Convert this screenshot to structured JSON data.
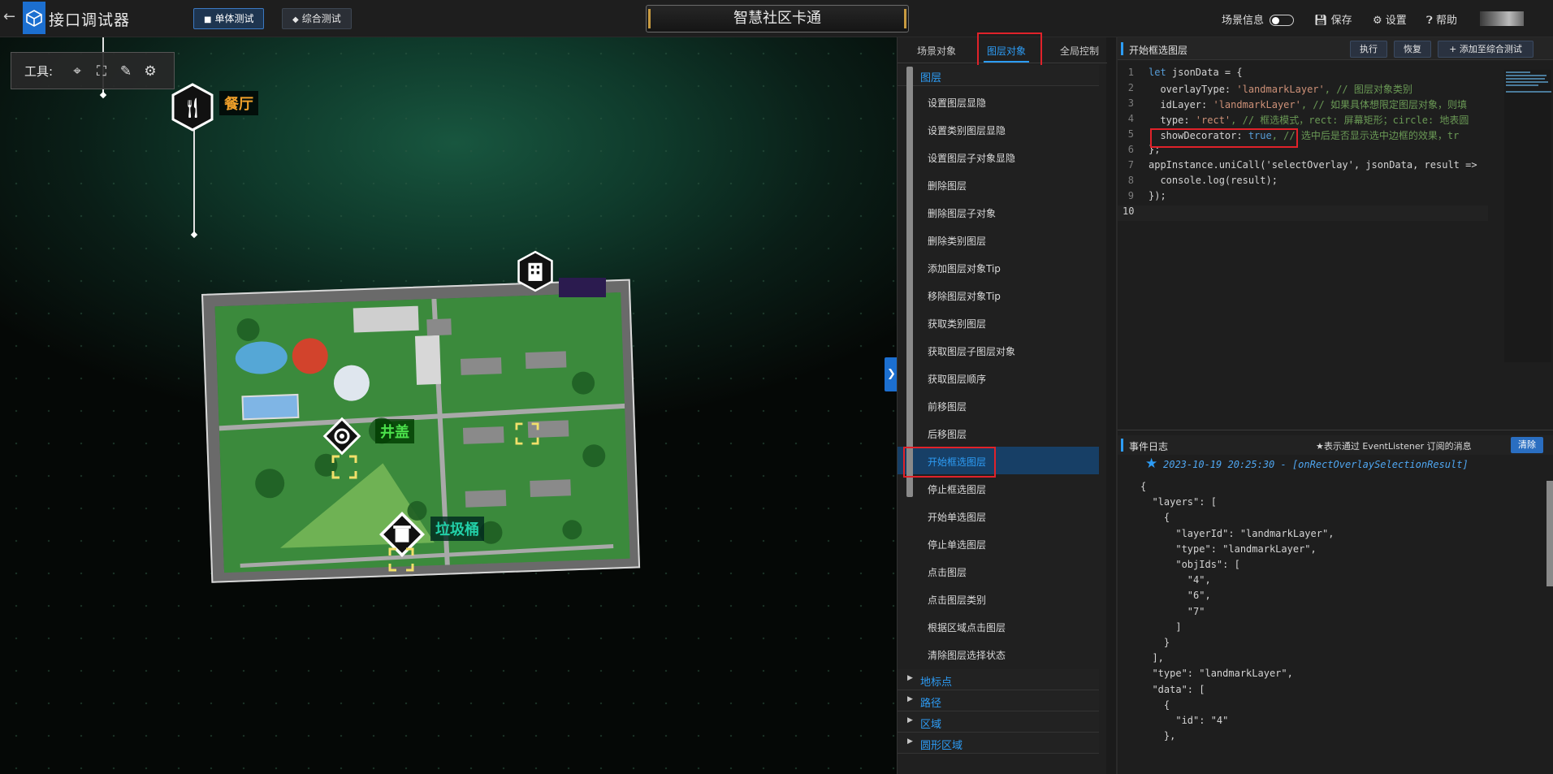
{
  "app": {
    "title": "接口调试器"
  },
  "header": {
    "tabs": [
      {
        "label": "单体测试"
      },
      {
        "label": "综合测试"
      }
    ],
    "scene_title": "智慧社区卡通",
    "scene_info_label": "场景信息",
    "save_label": "保存",
    "settings_label": "设置",
    "help_label": "帮助"
  },
  "toolbar": {
    "label": "工具:"
  },
  "pois": [
    {
      "label": "餐厅",
      "color": "#f0a02a"
    },
    {
      "label": "井盖",
      "color": "#4be04b"
    },
    {
      "label": "垃圾桶",
      "color": "#22d0a8"
    }
  ],
  "middle": {
    "tabs": [
      {
        "label": "场景对象"
      },
      {
        "label": "图层对象"
      },
      {
        "label": "全局控制"
      }
    ],
    "group_open": "图层",
    "items": [
      "设置图层显隐",
      "设置类别图层显隐",
      "设置图层子对象显隐",
      "删除图层",
      "删除图层子对象",
      "删除类别图层",
      "添加图层对象Tip",
      "移除图层对象Tip",
      "获取类别图层",
      "获取图层子图层对象",
      "获取图层顺序",
      "前移图层",
      "后移图层",
      "开始框选图层",
      "停止框选图层",
      "开始单选图层",
      "停止单选图层",
      "点击图层",
      "点击图层类别",
      "根据区域点击图层",
      "清除图层选择状态"
    ],
    "groups_collapsed": [
      "地标点",
      "路径",
      "区域",
      "圆形区域"
    ]
  },
  "editor": {
    "title": "开始框选图层",
    "run_label": "执行",
    "restore_label": "恢复",
    "add_label": "添加至综合测试",
    "line_numbers": [
      "1",
      "2",
      "3",
      "4",
      "5",
      "6",
      "7",
      "8",
      "9",
      "10"
    ],
    "code": {
      "l1_kw": "let",
      "l1_rest": " jsonData = {",
      "l2_key": "  overlayType: ",
      "l2_str": "'landmarkLayer'",
      "l2_cm": ", // 图层对象类别",
      "l3_key": "  idLayer: ",
      "l3_str": "'landmarkLayer'",
      "l3_cm": ", // 如果具体想限定图层对象，则填",
      "l4_key": "  type: ",
      "l4_str": "'rect'",
      "l4_cm": ", // 框选模式，rect: 屏幕矩形；circle: 地表圆",
      "l5_key": "  showDecorator: ",
      "l5_val": "true",
      "l5_cm": ", // 选中后是否显示选中边框的效果，tr",
      "l6": "};",
      "l7": "appInstance.uniCall('selectOverlay', jsonData, result =>",
      "l8": "  console.log(result);",
      "l9": "});"
    }
  },
  "log": {
    "title": "事件日志",
    "hint": "★表示通过 EventListener 订阅的消息",
    "clear_label": "清除",
    "entry_head": "2023-10-19 20:25:30 - [onRectOverlaySelectionResult]",
    "json_lines": [
      "{",
      "  \"layers\": [",
      "    {",
      "      \"layerId\": \"landmarkLayer\",",
      "      \"type\": \"landmarkLayer\",",
      "      \"objIds\": [",
      "        \"4\",",
      "        \"6\",",
      "        \"7\"",
      "      ]",
      "    }",
      "  ],",
      "  \"type\": \"landmarkLayer\",",
      "  \"data\": [",
      "    {",
      "      \"id\": \"4\"",
      "    },"
    ]
  },
  "colors": {
    "accent": "#2d9cf5",
    "highlight_box": "#e0222a",
    "logo": "#1c6fd0"
  }
}
